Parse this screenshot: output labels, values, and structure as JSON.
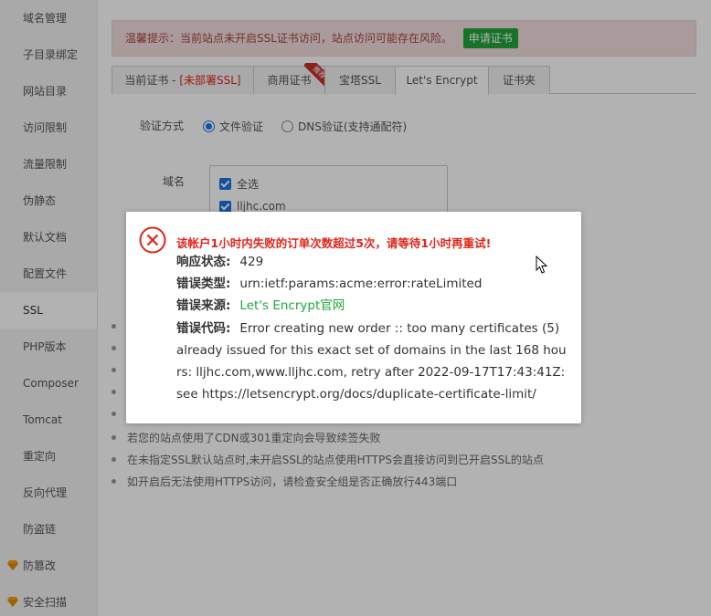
{
  "sidebar": {
    "items": [
      {
        "label": "域名管理"
      },
      {
        "label": "子目录绑定"
      },
      {
        "label": "网站目录"
      },
      {
        "label": "访问限制"
      },
      {
        "label": "流量限制"
      },
      {
        "label": "伪静态"
      },
      {
        "label": "默认文档"
      },
      {
        "label": "配置文件"
      },
      {
        "label": "SSL",
        "active": true
      },
      {
        "label": "PHP版本"
      },
      {
        "label": "Composer"
      },
      {
        "label": "Tomcat"
      },
      {
        "label": "重定向"
      },
      {
        "label": "反向代理"
      },
      {
        "label": "防盗链"
      },
      {
        "label": "防篡改",
        "icon": "diamond-icon"
      },
      {
        "label": "安全扫描",
        "icon": "diamond-icon"
      }
    ]
  },
  "warning": {
    "text": "温馨提示：当前站点未开启SSL证书访问，站点访问可能存在风险。",
    "button": "申请证书"
  },
  "tabs": {
    "current_cert_prefix": "当前证书 - ",
    "current_cert_status": "[未部署SSL]",
    "commercial": "商用证书",
    "ribbon": "推荐",
    "baota": "宝塔SSL",
    "letsencrypt": "Let's Encrypt",
    "cert_folder": "证书夹"
  },
  "form": {
    "verify_label": "验证方式",
    "file_verify": "文件验证",
    "dns_verify": "DNS验证(支持通配符)",
    "domain_label": "域名",
    "select_all": "全选",
    "domain1": "lljhc.com"
  },
  "tips": [
    "若您的站点使用了CDN或301重定向会导致续签失败",
    "在未指定SSL默认站点时,未开启SSL的站点使用HTTPS会直接访问到已开启SSL的站点",
    "如开启后无法使用HTTPS访问，请检查安全组是否正确放行443端口"
  ],
  "dialog": {
    "title": "该帐户1小时内失败的订单次数超过5次，请等待1小时再重试!",
    "status_label": "响应状态:",
    "status_value": "429",
    "type_label": "错误类型:",
    "type_value": "urn:ietf:params:acme:error:rateLimited",
    "source_label": "错误来源:",
    "source_value": "Let's Encrypt官网",
    "code_label": "错误代码:",
    "code_value": "Error creating new order :: too many certificates (5) already issued for this exact set of domains in the last 168 hours: lljhc.com,www.lljhc.com, retry after 2022-09-17T17:43:41Z: see https://letsencrypt.org/docs/duplicate-certificate-limit/"
  },
  "colors": {
    "brand_green": "#20a53a",
    "error_red": "#e0251a",
    "link_blue": "#1a73e8"
  }
}
